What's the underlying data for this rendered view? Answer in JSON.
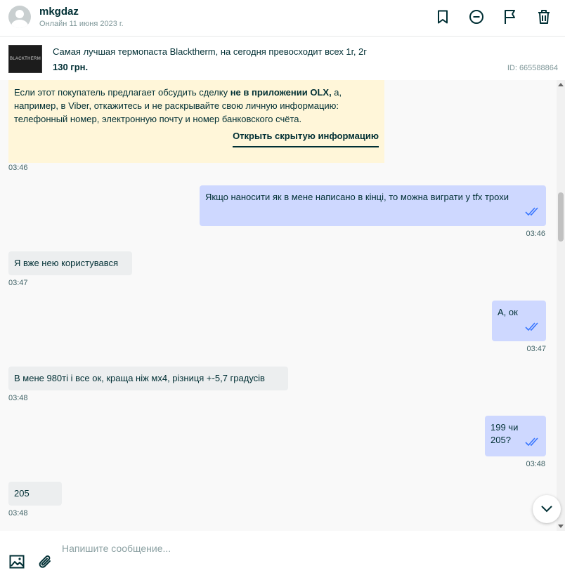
{
  "header": {
    "username": "mkgdaz",
    "status": "Онлайн 11 июня 2023 г."
  },
  "listing": {
    "thumb_text": "BLACKTHERM",
    "title": "Самая лучшая термопаста Blacktherm, на сегодня превосходит всех 1г, 2г",
    "price": "130 грн.",
    "id": "ID: 665588864"
  },
  "warning": {
    "text_before": "Если этот покупатель предлагает обсудить сделку ",
    "text_bold": "не в приложении OLX,",
    "text_after": " а, например, в Viber, откажитесь и не раскрывайте свою личную информацию: телефонный номер, электронную почту и номер банковского счёта.",
    "link": "Открыть скрытую информацию",
    "time": "03:46"
  },
  "messages": [
    {
      "dir": "out",
      "text": "Якщо наносити як в мене написано в кінці, то можна виграти у tfx трохи",
      "time": "03:46"
    },
    {
      "dir": "in",
      "text": "Я вже нею користувався",
      "time": "03:47"
    },
    {
      "dir": "out",
      "text": "А, ок",
      "time": "03:47"
    },
    {
      "dir": "in",
      "text": "В мене 980ті і все ок, краща ніж мх4, різниця +-5,7 градусів",
      "time": "03:48"
    },
    {
      "dir": "out",
      "text": "199 чи 205?",
      "time": "03:48"
    },
    {
      "dir": "in",
      "text": "205",
      "time": "03:48"
    }
  ],
  "composer": {
    "placeholder": "Напишите сообщение..."
  },
  "colors": {
    "text": "#002f34",
    "incoming_bubble": "#eceeef",
    "outgoing_bubble": "#ced8ff",
    "warning_bg": "#fff6d9",
    "read_ticks": "#3a77ff"
  }
}
